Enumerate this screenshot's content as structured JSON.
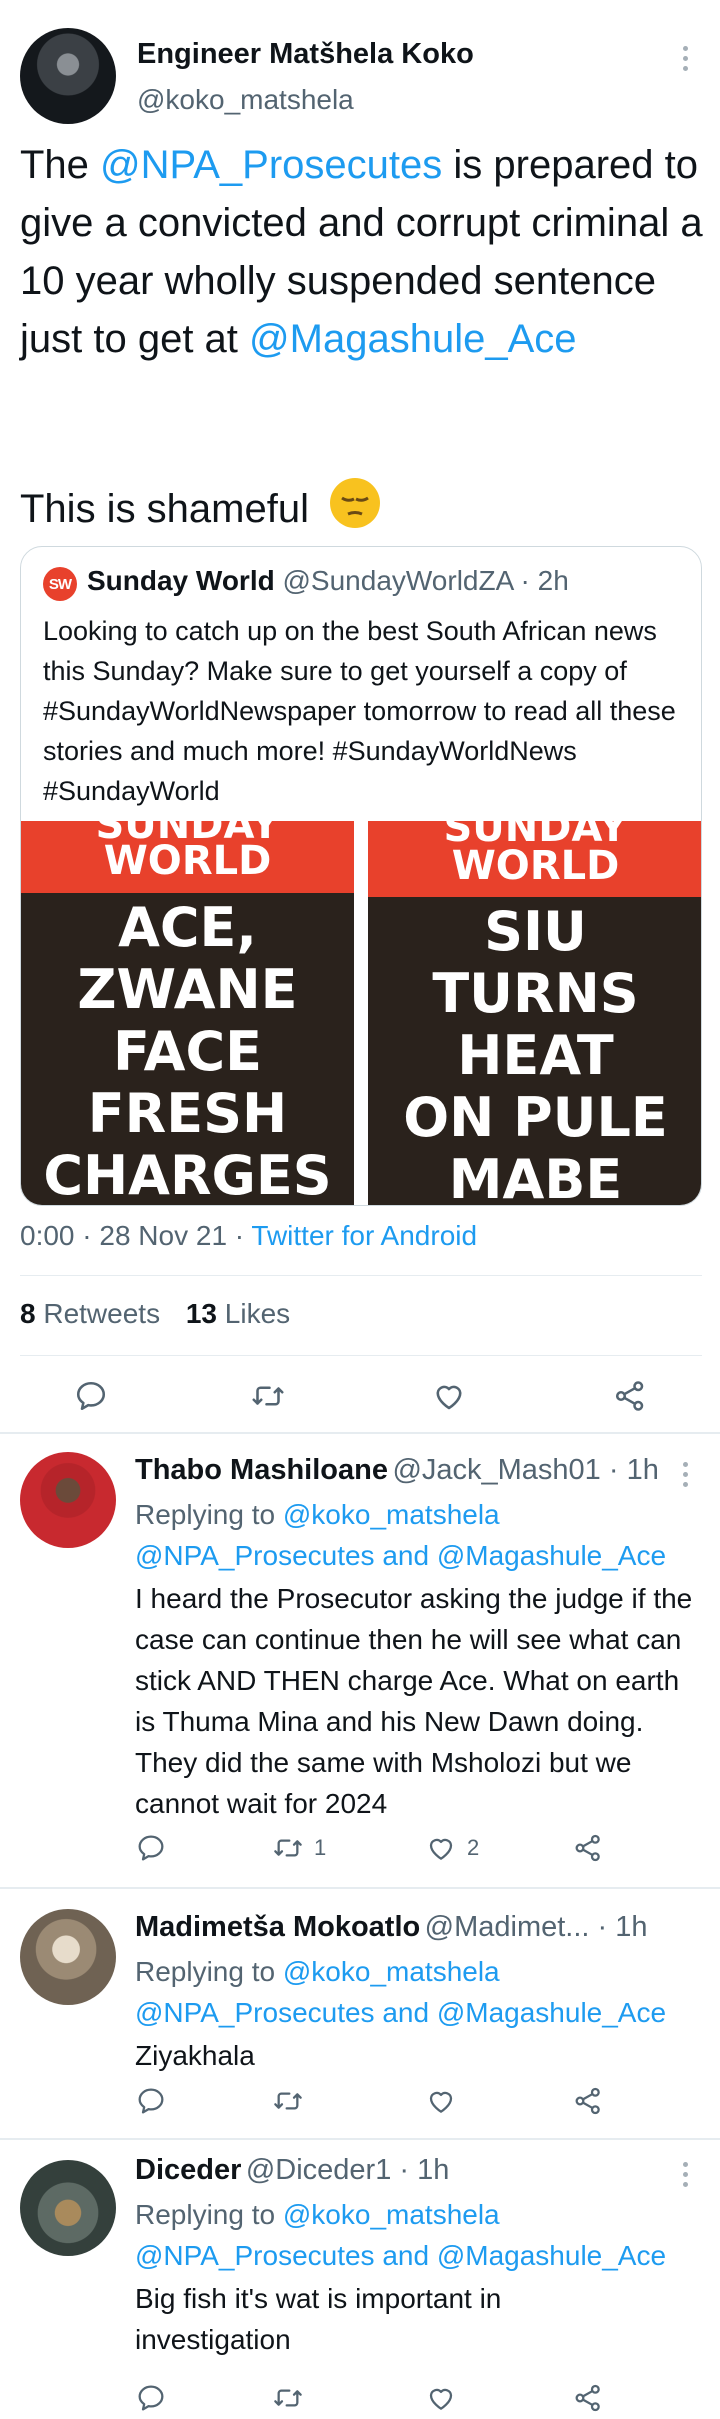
{
  "main_tweet": {
    "author_name": "Engineer Matšhela Koko",
    "author_handle": "@koko_matshela",
    "text_1": "The ",
    "mention_1": "@NPA_Prosecutes",
    "text_2": " is prepared to give a convicted and corrupt criminal a 10 year wholly suspended sentence just to get at ",
    "mention_2": "@Magashule_Ace",
    "text_3": "This is shameful",
    "emoji": "😔",
    "quoted": {
      "logo_text": "SW",
      "name": "Sunday World",
      "handle": "@SundayWorldZA",
      "time": "· 2h",
      "text": "Looking to catch up on the best South African news this Sunday? Make sure to get yourself a copy of #SundayWorldNewspaper tomorrow to read all these stories and much more! #SundayWorldNews #SundayWorld",
      "cover_left": {
        "masthead_top": "SUNDAY",
        "masthead_bottom": "WORLD",
        "headline": [
          "ACE,",
          "ZWANE",
          "FACE",
          "FRESH",
          "CHARGES"
        ]
      },
      "cover_right": {
        "masthead_top": "SUNDAY",
        "masthead_bottom": "WORLD",
        "headline": [
          "SIU",
          "TURNS",
          "HEAT",
          "ON PULE",
          "MABE"
        ]
      }
    },
    "timestamp": "0:00 · 28 Nov 21 · ",
    "source": "Twitter for Android",
    "stats": {
      "retweets_count": "8",
      "retweets_label": "Retweets",
      "likes_count": "13",
      "likes_label": "Likes"
    }
  },
  "replies": [
    {
      "name": "Thabo Mashiloane",
      "meta": "@Jack_Mash01 · 1h",
      "replying_prefix": "Replying to ",
      "replying_to_1": "@koko_matshela",
      "replying_to_2": "@NPA_Prosecutes and @Magashule_Ace",
      "text": "I heard the Prosecutor asking the judge if the case can continue then he will see what can stick AND THEN charge Ace. What on earth is Thuma Mina and his New Dawn doing. They did the same with Msholozi but we cannot wait for 2024",
      "retweets": "1",
      "likes": "2"
    },
    {
      "name": "Madimetša Mokoatlo",
      "meta": "@Madimet... · 1h",
      "replying_prefix": "Replying to ",
      "replying_to_1": "@koko_matshela",
      "replying_to_2": "@NPA_Prosecutes and @Magashule_Ace",
      "text": "Ziyakhala",
      "retweets": "",
      "likes": ""
    },
    {
      "name": "Diceder",
      "meta": "@Diceder1 · 1h",
      "replying_prefix": "Replying to ",
      "replying_to_1": "@koko_matshela",
      "replying_to_2": "@NPA_Prosecutes and @Magashule_Ace",
      "text": "Big fish it's wat is important in investigation",
      "retweets": "",
      "likes": ""
    }
  ],
  "icons": [
    "more-icon",
    "reply-icon",
    "retweet-icon",
    "like-icon",
    "share-icon"
  ],
  "colors": {
    "link": "#1d9bf0",
    "secondary": "#536471",
    "masthead_red": "#e8412c",
    "cover_dark": "#2a221c"
  }
}
